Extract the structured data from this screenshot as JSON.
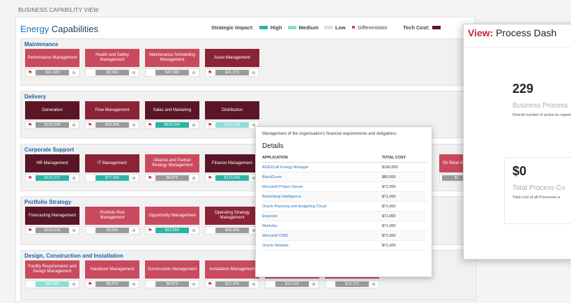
{
  "page_title": "BUSINESS CAPABILITY VIEW",
  "capabilities_title": {
    "accent": "Energy",
    "rest": "Capabilities"
  },
  "legend": {
    "strategic_impact_label": "Strategic Impact:",
    "high": "High",
    "medium": "Medium",
    "low": "Low",
    "differentiator": "Differentiator",
    "tech_cost_label": "Tech Cost:",
    "colors": {
      "high": "#2bb3a5",
      "medium": "#8fdcd6",
      "low": "#dedede",
      "flag": "#c0263e"
    }
  },
  "sections": [
    {
      "title": "Maintenance",
      "cards": [
        {
          "name": "Performance Management",
          "cost": "$31,028",
          "flag": true
        },
        {
          "name": "Health and Safety Management",
          "cost": "$3,550",
          "flag": false
        },
        {
          "name": "Maintenance Scheduling Management",
          "cost": "$47,608",
          "flag": false
        },
        {
          "name": "Asset Management",
          "cost": "$51,278",
          "flag": true
        }
      ]
    },
    {
      "title": "Delivery",
      "cards": [
        {
          "name": "Generation",
          "cost": "$132,508",
          "flag": true
        },
        {
          "name": "Flow Management",
          "cost": "$59,966",
          "flag": true
        },
        {
          "name": "Sales and Marketing",
          "cost": "$436,064",
          "flag": true
        },
        {
          "name": "Distribution",
          "cost": "$121,059",
          "flag": true
        }
      ]
    },
    {
      "title": "Corporate Support",
      "cards": [
        {
          "name": "HR Management",
          "cost": "$131,217",
          "flag": true
        },
        {
          "name": "IT Management",
          "cost": "$77,455",
          "flag": false
        },
        {
          "name": "Alliance and Partner Strategy Management",
          "cost": "$8,875",
          "flag": true
        },
        {
          "name": "Finance Management",
          "cost": "$170,842",
          "flag": true
        },
        {
          "name": "Str Relat Mana",
          "cost": "$1",
          "flag": false
        }
      ]
    },
    {
      "title": "Portfolio Strategy",
      "cards": [
        {
          "name": "Forecasting Management",
          "cost": "$152,628",
          "flag": true
        },
        {
          "name": "Portfolio Risk Management",
          "cost": "$3,550",
          "flag": false
        },
        {
          "name": "Opportunity Management",
          "cost": "$13,555",
          "flag": true
        },
        {
          "name": "Operating Strategy Management",
          "cost": "$59,058",
          "flag": false
        }
      ]
    },
    {
      "title": "Design, Construction and Installation",
      "cards": [
        {
          "name": "Facility Requirements and Design Management",
          "cost": "$39,280",
          "flag": false
        },
        {
          "name": "Handover Management",
          "cost": "$8,875",
          "flag": true
        },
        {
          "name": "Construction Management",
          "cost": "$8,875",
          "flag": false
        },
        {
          "name": "Installation Management",
          "cost": "$12,425",
          "flag": true
        },
        {
          "name": "Management",
          "cost": "$12,425",
          "flag": false
        },
        {
          "name": "",
          "cost": "$19,722",
          "flag": false
        }
      ]
    }
  ],
  "popup": {
    "description": "Management of the organisation's financial requirements and obligations",
    "title": "Details",
    "columns": [
      "APPLICATION",
      "TOTAL COST"
    ],
    "rows": [
      [
        "ADEXCell Energy Manager",
        "$196,000"
      ],
      [
        "BlackCurve",
        "$80,000"
      ],
      [
        "Microsoft Project Server",
        "$71,000"
      ],
      [
        "Bloomberg Intelligence",
        "$71,000"
      ],
      [
        "Oracle Planning and Budgeting Cloud",
        "$71,000"
      ],
      [
        "Experian",
        "$71,000"
      ],
      [
        "Workday",
        "$71,000"
      ],
      [
        "Microsoft O365",
        "$71,000"
      ],
      [
        "Oracle Netsuite",
        "$71,000"
      ]
    ]
  },
  "dashboard": {
    "title_prefix": "View:",
    "title_rest": "Process Dash",
    "metrics": [
      {
        "value": "229",
        "label": "Business Process",
        "desc": "Overall number of active bu organisation"
      },
      {
        "value": "$0",
        "label": "Total Process Co",
        "desc": "Total cost of all Processes a"
      }
    ]
  }
}
